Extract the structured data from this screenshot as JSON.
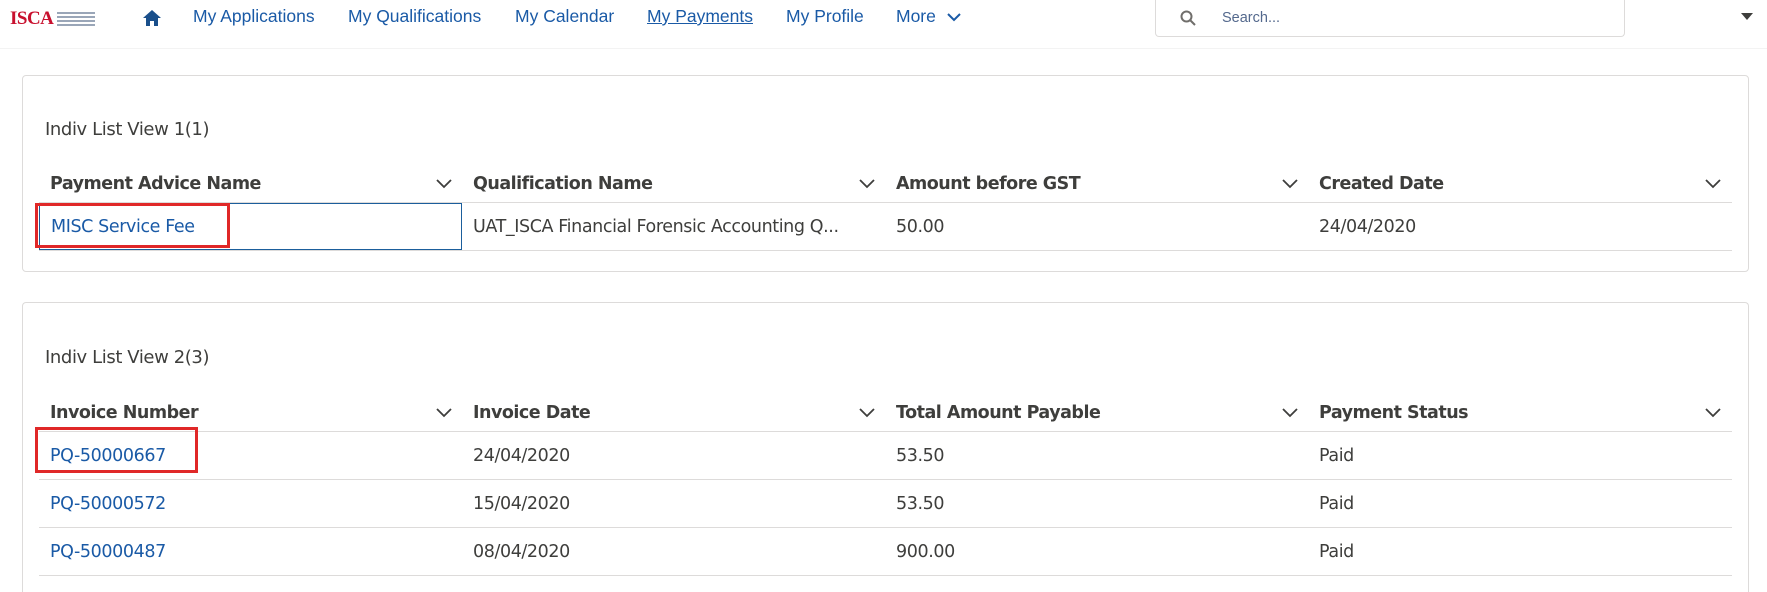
{
  "brand": {
    "logo_text": "ISCA",
    "colors": {
      "primary_red": "#c8102e",
      "link_blue": "#1a5aa6",
      "highlight_red": "#e02828"
    }
  },
  "nav": {
    "home_icon": "home-icon",
    "links": [
      {
        "label": "My Applications",
        "active": false
      },
      {
        "label": "My Qualifications",
        "active": false
      },
      {
        "label": "My Calendar",
        "active": false
      },
      {
        "label": "My Payments",
        "active": true
      },
      {
        "label": "My Profile",
        "active": false
      },
      {
        "label": "More",
        "active": false
      }
    ]
  },
  "search": {
    "placeholder": "Search..."
  },
  "list1": {
    "title": "Indiv List View 1(1)",
    "columns": [
      "Payment Advice Name",
      "Qualification Name",
      "Amount before GST",
      "Created Date"
    ],
    "rows": [
      [
        "MISC Service Fee",
        "UAT_ISCA Financial Forensic Accounting Q...",
        "50.00",
        "24/04/2020"
      ]
    ]
  },
  "list2": {
    "title": "Indiv List View 2(3)",
    "columns": [
      "Invoice Number",
      "Invoice Date",
      "Total Amount Payable",
      "Payment Status"
    ],
    "rows": [
      [
        "PQ-50000667",
        "24/04/2020",
        "53.50",
        "Paid"
      ],
      [
        "PQ-50000572",
        "15/04/2020",
        "53.50",
        "Paid"
      ],
      [
        "PQ-50000487",
        "08/04/2020",
        "900.00",
        "Paid"
      ]
    ]
  }
}
